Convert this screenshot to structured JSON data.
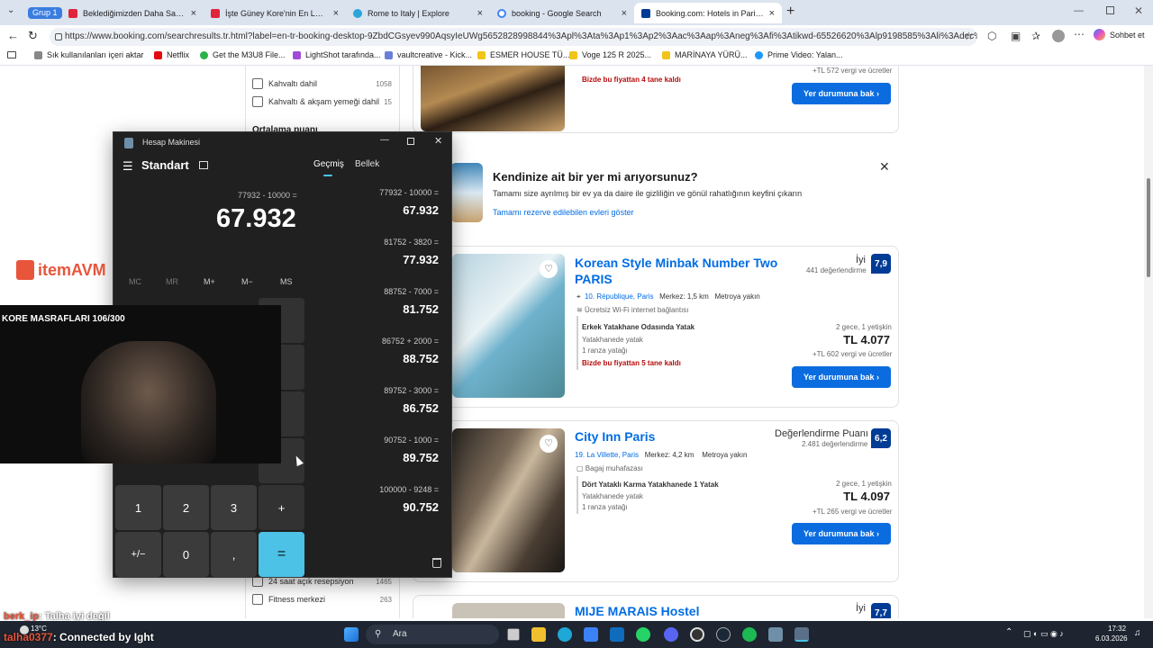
{
  "tabs": {
    "group_label": "Grup 1",
    "items": [
      {
        "label": "Beklediğimizden Daha Samimi Bir",
        "color": "#e0243c"
      },
      {
        "label": "İşte Güney Kore'nin En Lüks Bölge",
        "color": "#e0243c"
      },
      {
        "label": "Rome to Italy | Explore",
        "color": "#2aa6d8"
      },
      {
        "label": "booking - Google Search",
        "color": "#4285f4"
      },
      {
        "label": "Booking.com: Hotels in Paris. Otel",
        "color": "#003b95"
      }
    ],
    "close_glyph": "×",
    "new_tab_glyph": "+"
  },
  "address": {
    "url": "https://www.booking.com/searchresults.tr.html?label=en-tr-booking-desktop-9ZbdCGsyev990AqsyIeUWg5652828998844%3Apl%3Ata%3Ap1%3Ap2%3Aac%3Aap%3Aneg%3Afi%3Atikwd-65526620%3Alp9198585%3Ali%3Adec%3Adm...",
    "copilot_label": "Sohbet et"
  },
  "bookmarks": [
    {
      "label": "Sık kullanılanları içeri aktar",
      "color": "#888888"
    },
    {
      "label": "Netflix",
      "color": "#e50914"
    },
    {
      "label": "Get the M3U8 File...",
      "color": "#29b34a"
    },
    {
      "label": "LightShot tarafında...",
      "color": "#a14cd8"
    },
    {
      "label": "vaultcreative - Kick...",
      "color": "#6b7fd8"
    },
    {
      "label": "ESMER HOUSE TÜ...",
      "color": "#f0c419"
    },
    {
      "label": "Voge 125 R 2025...",
      "color": "#f0c419"
    },
    {
      "label": "MARİNAYA YÜRÜ...",
      "color": "#f0c419"
    },
    {
      "label": "Prime Video: Yalan...",
      "color": "#1a98ff"
    }
  ],
  "filters": {
    "items": [
      {
        "label": "Kahvaltı dahil",
        "count": "1058"
      },
      {
        "label": "Kahvaltı & akşam yemeği dahil",
        "count": "15"
      }
    ],
    "section_title": "Ortalama puanı",
    "bottom_items": [
      {
        "label": "24 saat açık resepsiyon",
        "count": "1465"
      },
      {
        "label": "Fitness merkezi",
        "count": "263"
      }
    ]
  },
  "listing_top": {
    "availability": "Bizde bu fiyattan 4 tane kaldı",
    "tax": "+TL 572 vergi ve ücretler",
    "button": "Yer durumuna bak"
  },
  "promo": {
    "title": "Kendinize ait bir yer mi arıyorsunuz?",
    "text": "Tamamı size ayrılmış bir ev ya da daire ile gizliliğin ve gönül rahatlığının keyfini çıkarın",
    "link": "Tamamı rezerve edilebilen evleri göster"
  },
  "hotels": [
    {
      "name": "Korean Style Minbak Number Two PARIS",
      "rating_word": "İyi",
      "reviews": "441 değerlendirme",
      "score": "7,9",
      "district": "10. République, Paris",
      "distance": "Merkez: 1,5 km",
      "metro": "Metroya yakın",
      "amenity": "Ücretsiz Wi-Fi internet bağlantısı",
      "room": "Erkek Yatakhane Odasında Yatak",
      "room_type": "Yatakhanede yatak",
      "bed": "1 ranza yatağı",
      "availability": "Bizde bu fiyattan 5 tane kaldı",
      "nights": "2 gece, 1 yetişkin",
      "price": "TL 4.077",
      "tax": "+TL 602 vergi ve ücretler",
      "button": "Yer durumuna bak"
    },
    {
      "name": "City Inn Paris",
      "rating_word": "Değerlendirme Puanı",
      "reviews": "2.481 değerlendirme",
      "score": "6,2",
      "district": "19. La Villette, Paris",
      "distance": "Merkez: 4,2 km",
      "metro": "Metroya yakın",
      "amenity": "Bagaj muhafazası",
      "room": "Dört Yataklı Karma Yatakhanede 1 Yatak",
      "room_type": "Yatakhanede yatak",
      "bed": "1 ranza yatağı",
      "nights": "2 gece, 1 yetişkin",
      "price": "TL 4.097",
      "tax": "+TL 265 vergi ve ücretler",
      "button": "Yer durumuna bak"
    },
    {
      "name": "MIJE MARAIS Hostel",
      "rating_word": "İyi",
      "score": "7,7"
    }
  ],
  "calculator": {
    "window_title": "Hesap Makinesi",
    "mode": "Standart",
    "tab_history": "Geçmiş",
    "tab_memory": "Bellek",
    "expression": "77932 - 10000 =",
    "display": "67.932",
    "memory_keys": [
      "MC",
      "MR",
      "M+",
      "M−",
      "MS"
    ],
    "keys": {
      "one": "1",
      "two": "2",
      "three": "3",
      "plus": "+",
      "negate": "+/−",
      "zero": "0",
      "decimal": ",",
      "equals": "="
    },
    "history": [
      {
        "expr": "77932  -  10000 =",
        "result": "67.932"
      },
      {
        "expr": "81752  -  3820 =",
        "result": "77.932"
      },
      {
        "expr": "88752  -  7000 =",
        "result": "81.752"
      },
      {
        "expr": "86752  +  2000 =",
        "result": "88.752"
      },
      {
        "expr": "89752  -  3000 =",
        "result": "86.752"
      },
      {
        "expr": "90752  -  1000 =",
        "result": "89.752"
      },
      {
        "expr": "100000  -  9248 =",
        "result": "90.752"
      }
    ]
  },
  "overlay": {
    "logo": "itemAVM",
    "counter": "KORE MASRAFLARI 106/300",
    "chat_user": "berk_ip",
    "chat_message": ": Talha iyi değil",
    "chat_user2": "talha0377",
    "connection": ": Connected by Ight"
  },
  "taskbar": {
    "search_label": "Ara",
    "weather": "13°C",
    "time": "17:32",
    "date": "6.03.2026"
  }
}
